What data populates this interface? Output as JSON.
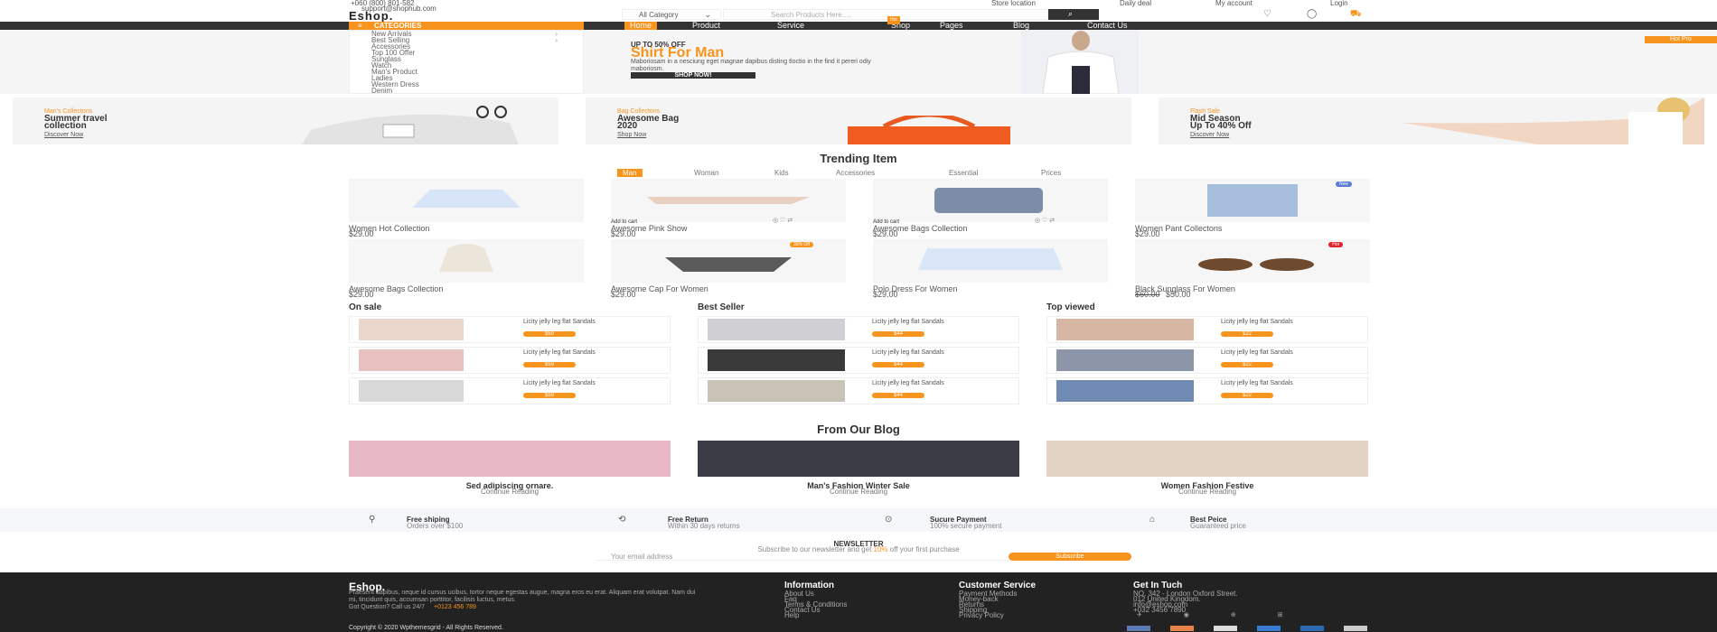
{
  "topbar": {
    "phone": "+060 (800) 801-582",
    "email": "support@shophub.com",
    "links": [
      "Store location",
      "Daily deal",
      "My account",
      "Login"
    ]
  },
  "header": {
    "logo": "Eshop.",
    "category_select": "All Category",
    "search_placeholder": "Search Products Here.....",
    "search_button": ""
  },
  "nav": {
    "categories_label": "CATEGORIES",
    "items": [
      "Home",
      "Product",
      "Service",
      "Shop",
      "Pages",
      "Blog",
      "Contact Us"
    ],
    "shop_badge": "Hot"
  },
  "categories": [
    "New Arrivals",
    "Best Selling",
    "Accessories",
    "Top 100 Offer",
    "Sunglass",
    "Watch",
    "Man's Product",
    "Ladies",
    "Western Dress",
    "Denim"
  ],
  "hero": {
    "kicker": "UP TO 50% OFF",
    "title": "Shirt For Man",
    "desc": "Maboriosam in a nesciung eget magnae dapibus disting tloctio in the find it pereri odiy maboriosm.",
    "button": "SHOP NOW!",
    "corner_badge": "Hot Pro"
  },
  "banners": [
    {
      "kicker": "Man's Collectons",
      "title_line1": "Summer travel",
      "title_line2": "collection",
      "link": "Discover Now"
    },
    {
      "kicker": "Bag Collectons",
      "title_line1": "Awesome Bag",
      "title_line2": "2020",
      "link": "Shop Now"
    },
    {
      "kicker": "Flash Sale",
      "title_line1": "Mid Season",
      "title_line2": "Up To 40% Off",
      "link": "Discover Now"
    }
  ],
  "trending": {
    "title": "Trending Item",
    "tabs": [
      "Man",
      "Woman",
      "Kids",
      "Accessories",
      "Essential",
      "Prices"
    ],
    "products": [
      {
        "name": "Women Hot Collection",
        "price": "$29.00",
        "badge": ""
      },
      {
        "name": "Awesome Pink Show",
        "price": "$29.00",
        "badge": "",
        "add": "Add to cart"
      },
      {
        "name": "Awesome Bags Collection",
        "price": "$29.00",
        "badge": "",
        "add": "Add to cart"
      },
      {
        "name": "Women Pant Collectons",
        "price": "$29.00",
        "badge": "New"
      },
      {
        "name": "Awesome Bags Collection",
        "price": "$29.00",
        "badge": ""
      },
      {
        "name": "Awesome Cap For Women",
        "price": "$29.00",
        "badge": "30% Off"
      },
      {
        "name": "Polo Dress For Women",
        "price": "$29.00",
        "badge": ""
      },
      {
        "name": "Black Sunglass For Women",
        "price": "$60.00",
        "old_price": "$50.00",
        "badge": "Hot"
      }
    ]
  },
  "lists": [
    {
      "title": "On sale",
      "items": [
        "Licity jelly leg flat Sandals",
        "Licity jelly leg flat Sandals",
        "Licity jelly leg flat Sandals"
      ],
      "price": "$59"
    },
    {
      "title": "Best Seller",
      "items": [
        "Licity jelly leg flat Sandals",
        "Licity jelly leg flat Sandals",
        "Licity jelly leg flat Sandals"
      ],
      "price": "$44"
    },
    {
      "title": "Top viewed",
      "items": [
        "Licity jelly leg flat Sandals",
        "Licity jelly leg flat Sandals",
        "Licity jelly leg flat Sandals"
      ],
      "price": "$22"
    }
  ],
  "blog": {
    "title": "From Our Blog",
    "posts": [
      {
        "title": "Sed adipiscing ornare.",
        "link": "Continue Reading"
      },
      {
        "title": "Man's Fashion Winter Sale",
        "link": "Continue Reading"
      },
      {
        "title": "Women Fashion Festive",
        "link": "Continue Reading"
      }
    ]
  },
  "services": [
    {
      "title": "Free shiping",
      "desc": "Orders over $100"
    },
    {
      "title": "Free Return",
      "desc": "Within 30 days returns"
    },
    {
      "title": "Sucure Payment",
      "desc": "100% secure payment"
    },
    {
      "title": "Best Peice",
      "desc": "Guaranteed price"
    }
  ],
  "newsletter": {
    "title": "Newsletter",
    "text": "Subscribe to our newsletter and get",
    "highlight": "10%",
    "text_end": "off your first purchase",
    "placeholder": "Your email address",
    "button": "Subscribe"
  },
  "footer": {
    "logo": "Eshop.",
    "about": "Praesent dapibus, neque id cursus ucibus, tortor neque egestas augue, magna eros eu erat. Aliquam erat volutpat. Nam dui mi, tincidunt quis, accumsan porttitor, facilisis luctus, metus.",
    "question": "Got Question? Call us 24/7",
    "phone": "+0123 456 789",
    "columns": [
      {
        "title": "Information",
        "items": [
          "About Us",
          "Faq",
          "Terms & Conditions",
          "Contact Us",
          "Help"
        ]
      },
      {
        "title": "Customer Service",
        "items": [
          "Payment Methods",
          "Money-back",
          "Returns",
          "Shipping",
          "Privacy Policy"
        ]
      },
      {
        "title": "Get In Tuch",
        "items": [
          "NO. 342 - London Oxford Street.",
          "012 United Kingdom.",
          "info@eshop.com",
          "+032 3456 7890"
        ]
      }
    ],
    "copyright": "Copyright © 2020 Wpthemesgrid  -  All Rights Reserved."
  },
  "colors": {
    "accent": "#f7941d",
    "dark": "#333333",
    "footer": "#222222"
  }
}
